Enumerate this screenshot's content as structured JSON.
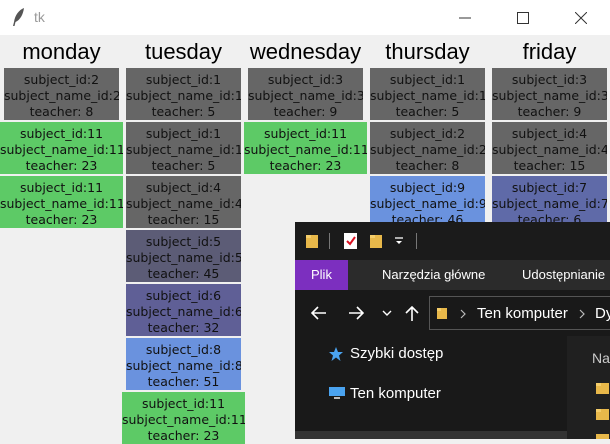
{
  "window": {
    "title": "tk",
    "controls": [
      "minimize-icon",
      "maximize-icon",
      "close-icon"
    ]
  },
  "schedule": {
    "days": [
      {
        "name": "monday",
        "cards": [
          {
            "line1": "subject_id:2",
            "line2": "subject_name_id:2",
            "line3": "teacher: 8",
            "color": "#666666"
          },
          {
            "line1": "subject_id:11",
            "line2": "subject_name_id:11",
            "line3": "teacher: 23",
            "color": "#5dca66"
          },
          {
            "line1": "subject_id:11",
            "line2": "subject_name_id:11",
            "line3": "teacher: 23",
            "color": "#5dca66"
          }
        ]
      },
      {
        "name": "tuesday",
        "cards": [
          {
            "line1": "subject_id:1",
            "line2": "subject_name_id:1",
            "line3": "teacher: 5",
            "color": "#666666"
          },
          {
            "line1": "subject_id:1",
            "line2": "subject_name_id:1",
            "line3": "teacher: 5",
            "color": "#666666"
          },
          {
            "line1": "subject_id:4",
            "line2": "subject_name_id:4",
            "line3": "teacher: 15",
            "color": "#666666"
          },
          {
            "line1": "subject_id:5",
            "line2": "subject_name_id:5",
            "line3": "teacher: 45",
            "color": "#5c5c76"
          },
          {
            "line1": "subject_id:6",
            "line2": "subject_name_id:6",
            "line3": "teacher: 32",
            "color": "#5f5f96"
          },
          {
            "line1": "subject_id:8",
            "line2": "subject_name_id:8",
            "line3": "teacher: 51",
            "color": "#6a92de"
          },
          {
            "line1": "subject_id:11",
            "line2": "subject_name_id:11",
            "line3": "teacher: 23",
            "color": "#5dca66"
          }
        ]
      },
      {
        "name": "wednesday",
        "cards": [
          {
            "line1": "subject_id:3",
            "line2": "subject_name_id:3",
            "line3": "teacher: 9",
            "color": "#666666"
          },
          {
            "line1": "subject_id:11",
            "line2": "subject_name_id:11",
            "line3": "teacher: 23",
            "color": "#5dca66"
          }
        ]
      },
      {
        "name": "thursday",
        "cards": [
          {
            "line1": "subject_id:1",
            "line2": "subject_name_id:1",
            "line3": "teacher: 5",
            "color": "#666666"
          },
          {
            "line1": "subject_id:2",
            "line2": "subject_name_id:2",
            "line3": "teacher: 8",
            "color": "#666666"
          },
          {
            "line1": "subject_id:9",
            "line2": "subject_name_id:9",
            "line3": "teacher: 46",
            "color": "#6a92de"
          }
        ]
      },
      {
        "name": "friday",
        "cards": [
          {
            "line1": "subject_id:3",
            "line2": "subject_name_id:3",
            "line3": "teacher: 9",
            "color": "#666666"
          },
          {
            "line1": "subject_id:4",
            "line2": "subject_name_id:4",
            "line3": "teacher: 15",
            "color": "#666666"
          },
          {
            "line1": "subject_id:7",
            "line2": "subject_name_id:7",
            "line3": "teacher: 6",
            "color": "#5f6aa8"
          }
        ]
      }
    ]
  },
  "explorer": {
    "ribbon_tabs": [
      "Plik",
      "Narzędzia główne",
      "Udostępnianie"
    ],
    "active_tab_color": "#7c2fbf",
    "breadcrumb": [
      "Ten komputer",
      "Dy"
    ],
    "nav_items": [
      "Szybki dostęp",
      "Ten komputer"
    ],
    "column_header": "Na"
  }
}
